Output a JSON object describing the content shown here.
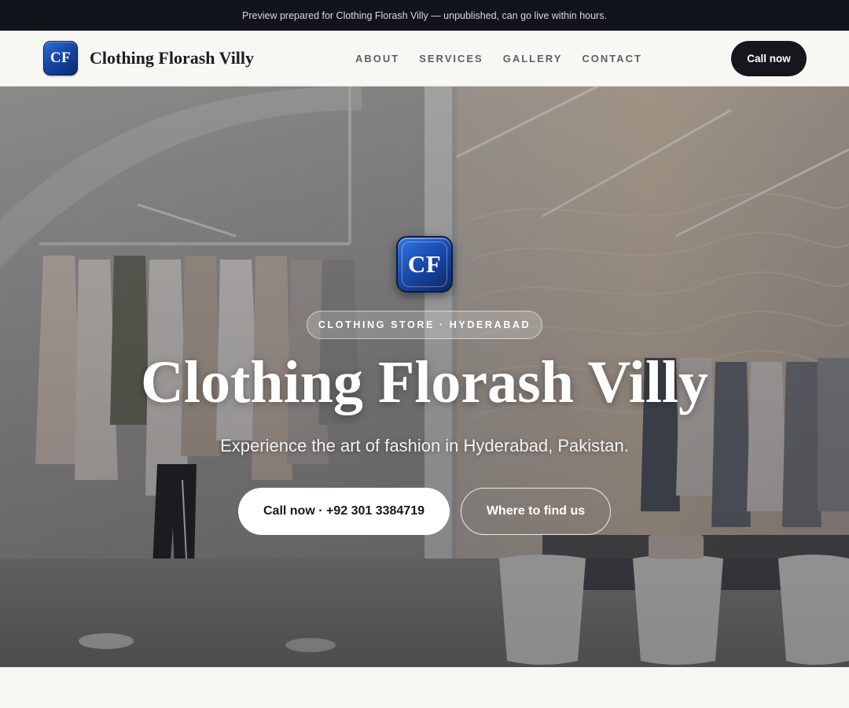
{
  "preview_banner": "Preview prepared for Clothing Florash Villy — unpublished, can go live within hours.",
  "brand": {
    "logo_text": "CF",
    "name": "Clothing Florash Villy"
  },
  "nav": {
    "items": [
      "ABOUT",
      "SERVICES",
      "GALLERY",
      "CONTACT"
    ],
    "cta": "Call now"
  },
  "hero": {
    "logo_text": "CF",
    "tag": "CLOTHING STORE · HYDERABAD",
    "title": "Clothing Florash Villy",
    "subtitle": "Experience the art of fashion in Hyderabad, Pakistan.",
    "primary_button": "Call now · +92 301 3384719",
    "secondary_button": "Where to find us"
  },
  "colors": {
    "dark": "#11141a",
    "background": "#f8f7f3",
    "logo_blue": "#1a4cb0"
  }
}
